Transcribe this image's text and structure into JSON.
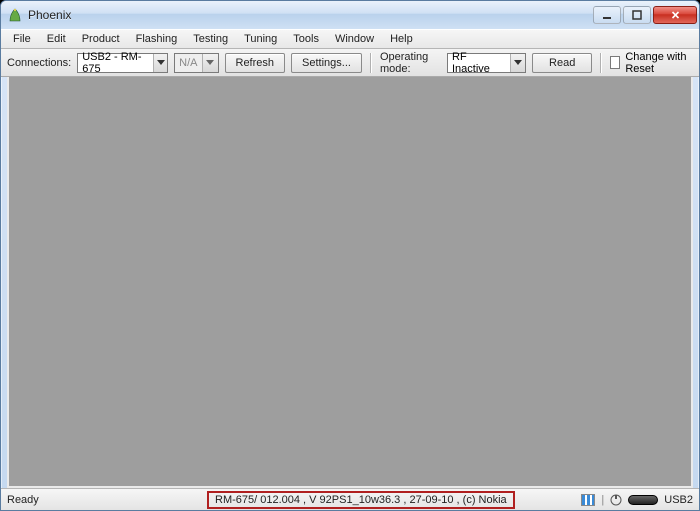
{
  "window": {
    "title": "Phoenix"
  },
  "menu": {
    "file": "File",
    "edit": "Edit",
    "product": "Product",
    "flashing": "Flashing",
    "testing": "Testing",
    "tuning": "Tuning",
    "tools": "Tools",
    "window": "Window",
    "help": "Help"
  },
  "toolbar": {
    "connections_label": "Connections:",
    "connection_value": "USB2 - RM-675",
    "na_value": "N/A",
    "refresh": "Refresh",
    "settings": "Settings...",
    "op_mode_label": "Operating mode:",
    "op_mode_value": "RF Inactive",
    "read": "Read",
    "change_with_reset": "Change with Reset"
  },
  "status": {
    "ready": "Ready",
    "info": "RM-675/ 012.004 , V 92PS1_10w36.3 , 27-09-10 , (c) Nokia",
    "usb": "USB2"
  }
}
